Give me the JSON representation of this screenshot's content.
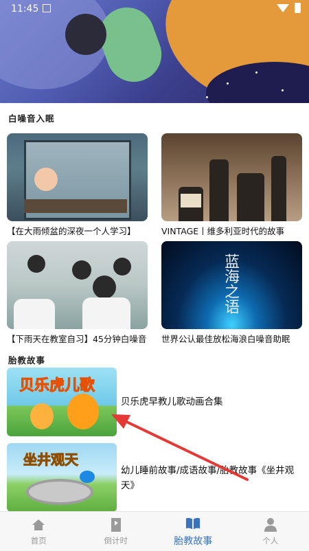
{
  "status_bar": {
    "time": "11:45"
  },
  "sections": {
    "white_noise": "白噪音入眠",
    "prenatal_stories": "胎教故事"
  },
  "white_noise_cards": [
    {
      "title": "【在大雨倾盆的深夜一个人学习】"
    },
    {
      "title": "VINTAGE丨维多利亚时代的故事"
    },
    {
      "title": "【下雨天在教室自习】45分钟白噪音"
    },
    {
      "title": "世界公认最佳放松海浪白噪音助眠"
    }
  ],
  "thumb_text": {
    "sea": "蓝海之语",
    "tiger_logo": "贝乐虎儿歌",
    "well_logo": "坐井观天"
  },
  "stories": [
    {
      "title": "贝乐虎早教儿歌动画合集"
    },
    {
      "title": "幼儿睡前故事/成语故事/胎教故事《坐井观天》"
    }
  ],
  "bottom_nav": {
    "items": [
      {
        "label": "首页",
        "icon": "home-icon"
      },
      {
        "label": "倒计时",
        "icon": "countdown-icon"
      },
      {
        "label": "胎教故事",
        "icon": "book-icon"
      },
      {
        "label": "个人",
        "icon": "person-icon"
      }
    ],
    "active_index": 2,
    "active_color": "#3b73b9",
    "inactive_color": "#9a9a9a"
  },
  "annotation": {
    "color": "#e53935"
  }
}
